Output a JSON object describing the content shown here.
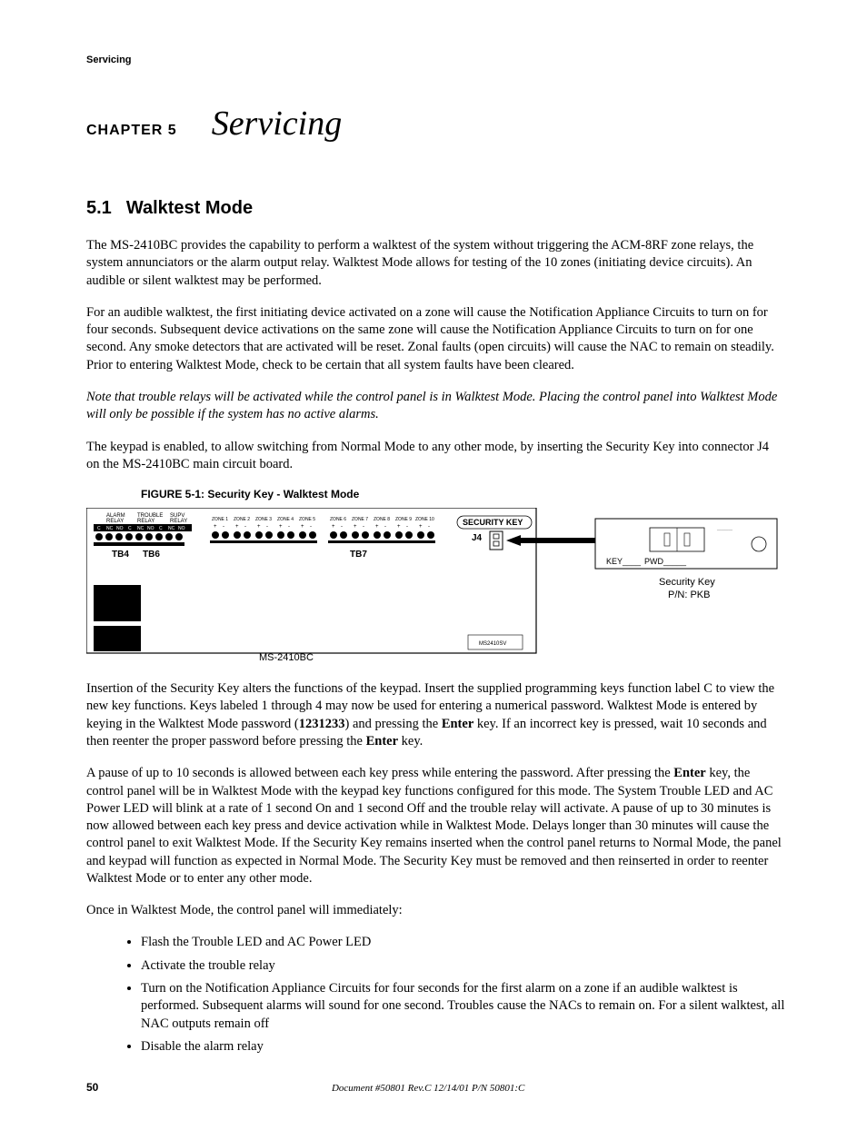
{
  "running_head": "Servicing",
  "chapter": {
    "label": "CHAPTER 5",
    "title": "Servicing"
  },
  "section": {
    "number": "5.1",
    "title": "Walktest Mode"
  },
  "para1": "The MS-2410BC provides the capability to perform a walktest of the system without triggering the ACM-8RF zone relays, the system annunciators or the alarm output relay.  Walktest Mode allows for testing of the 10 zones (initiating device circuits).  An audible or silent walktest may be performed.",
  "para2": "For an audible walktest, the first initiating device activated on a zone will cause the Notification Appliance Circuits to turn on for four seconds.  Subsequent device activations on the same zone will cause the Notification Appliance Circuits to turn on for one second.  Any smoke detectors that are activated will be reset.  Zonal faults (open circuits) will cause the NAC to remain on steadily.  Prior to entering Walktest Mode, check to be certain that all system faults have been cleared.",
  "note": "Note that trouble relays will be activated while the control panel is in Walktest Mode.  Placing the control panel into Walktest Mode will only be possible if the system has no active alarms.",
  "para3": "The keypad is enabled, to allow switching from Normal Mode to any other mode, by inserting the Security Key into connector J4 on the MS-2410BC main circuit board.",
  "figure": {
    "label": "FIGURE 5-1:",
    "title": "Security Key - Walktest Mode",
    "board_label": "MS-2410BC",
    "tb4": "TB4",
    "tb6": "TB6",
    "tb7": "TB7",
    "j4": "J4",
    "security_key_label": "SECURITY KEY",
    "key_label": "KEY____",
    "pwd_label": "PWD_____",
    "sk_caption1": "Security Key",
    "sk_caption2": "P/N: PKB",
    "relay1_a": "ALARM",
    "relay1_b": "RELAY",
    "relay2_a": "TROUBLE",
    "relay2_b": "RELAY",
    "relay3_a": "SUPV",
    "relay3_b": "RELAY",
    "nc": "NC",
    "no": "NO",
    "c": "C",
    "zone_prefix": "ZONE",
    "plus": "+",
    "minus": "-",
    "chip": "MS2410SV"
  },
  "para4_a": "Insertion of the Security Key alters the functions of the keypad.  Insert the supplied programming keys function label C to view the new key functions.  Keys labeled 1 through 4 may now be used for entering a numerical password.  Walktest Mode is entered by keying in the Walktest Mode password (",
  "para4_pw": "1231233",
  "para4_b": ") and pressing the ",
  "para4_enter": "Enter",
  "para4_c": " key.  If an incorrect key is pressed, wait 10 seconds and then reenter the proper password before pressing the ",
  "para4_d": " key.",
  "para5_a": "A pause of up to 10 seconds is allowed between each key press while entering the password.  After pressing the ",
  "para5_enter": "Enter",
  "para5_b": " key, the control panel will be in Walktest Mode with the keypad key functions configured for this mode.  The System Trouble LED and AC Power LED will blink at a rate of 1 second On and 1 second Off and the trouble relay will activate.  A pause of up to 30 minutes is now allowed between each key press and device activation while in Walktest Mode.  Delays longer than 30 minutes will cause the control panel to exit Walktest Mode.  If the Security Key remains inserted when the control panel returns to Normal Mode, the panel and keypad will function as expected in Normal Mode.  The Security Key must be removed and then reinserted in order to reenter Walktest Mode or to enter any other mode.",
  "para6": "Once in Walktest Mode, the control panel will immediately:",
  "bullets": [
    "Flash the Trouble LED and AC Power LED",
    "Activate the trouble relay",
    "Turn on the Notification Appliance Circuits for four seconds for the first alarm on a zone if an audible walktest is performed.  Subsequent alarms will sound for one second.  Troubles cause the NACs to remain on.  For a silent walktest, all NAC outputs remain off",
    "Disable the alarm relay"
  ],
  "footer": {
    "page": "50",
    "docinfo": "Document #50801    Rev.C    12/14/01    P/N 50801:C"
  }
}
